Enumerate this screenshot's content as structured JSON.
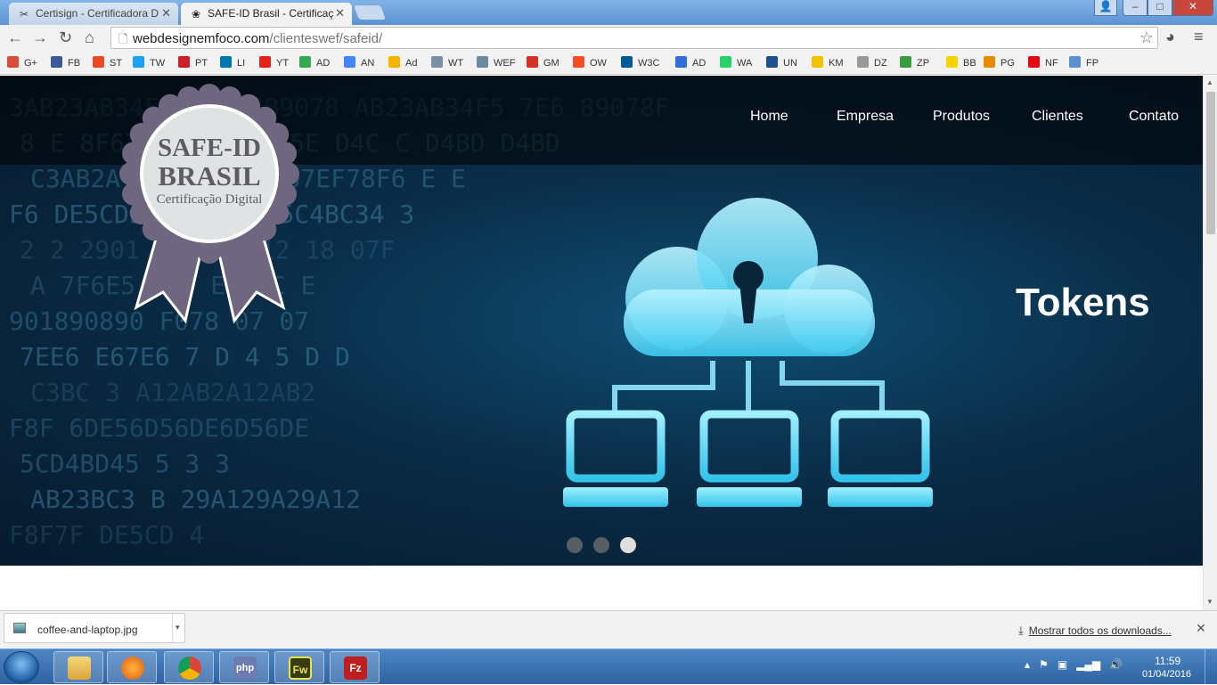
{
  "tabs": [
    {
      "title": "Certisign - Certificadora D",
      "active": false
    },
    {
      "title": "SAFE-ID Brasil - Certificaç",
      "active": true
    }
  ],
  "window_controls": {
    "minimize": "–",
    "maximize": "□",
    "close": "✕"
  },
  "address": {
    "host": "webdesignemfoco.com",
    "path": "/clienteswef/safeid/"
  },
  "bookmarks": [
    {
      "label": "G+",
      "color": "#dd4b39"
    },
    {
      "label": "FB",
      "color": "#3b5998"
    },
    {
      "label": "ST",
      "color": "#eb4924"
    },
    {
      "label": "TW",
      "color": "#1da1f2"
    },
    {
      "label": "PT",
      "color": "#cb2027"
    },
    {
      "label": "LI",
      "color": "#0077b5"
    },
    {
      "label": "YT",
      "color": "#e62117"
    },
    {
      "label": "AD",
      "color": "#34a853"
    },
    {
      "label": "AN",
      "color": "#4285f4"
    },
    {
      "label": "Ad",
      "color": "#f4b400"
    },
    {
      "label": "WT",
      "color": "#7a8fa8"
    },
    {
      "label": "WEF",
      "color": "#6a8aa0"
    },
    {
      "label": "GM",
      "color": "#d93025"
    },
    {
      "label": "OW",
      "color": "#f25022"
    },
    {
      "label": "W3C",
      "color": "#005a9c"
    },
    {
      "label": "AD",
      "color": "#2f6fdb"
    },
    {
      "label": "WA",
      "color": "#25d366"
    },
    {
      "label": "UN",
      "color": "#1d4f91"
    },
    {
      "label": "KM",
      "color": "#f2c200"
    },
    {
      "label": "DZ",
      "color": "#999999"
    },
    {
      "label": "ZP",
      "color": "#3a9d3a"
    },
    {
      "label": "BB",
      "color": "#f6d300"
    },
    {
      "label": "PG",
      "color": "#e68a00"
    },
    {
      "label": "NF",
      "color": "#e50914"
    },
    {
      "label": "FP",
      "color": "#5b8fd1"
    }
  ],
  "site": {
    "logo": {
      "line1": "SAFE-ID",
      "line2": "BRASIL",
      "line3": "Certificação Digital"
    },
    "nav": [
      "Home",
      "Empresa",
      "Produtos",
      "Clientes",
      "Contato"
    ],
    "slide_title": "Tokens",
    "slider": {
      "count": 3,
      "active": 3
    }
  },
  "hero_code_rows": [
    "3AB23AB34F  8F  8F6B9078  AB23AB34F5   7E6  89078F",
    "8  E  8F67E6 5E6 45 5E D4C  C   D4BD  D4BD",
    "C3AB2A  9 8  2 90 F07EF78F6 E E",
    "F6 DE5CDS 4CD C 5 5C4BC34 3",
    "2 2 2901 89  8 9012 18 07F",
    "A 7F6E5 7 F E D C E",
    "901890890  F078  07 07",
    "7EE6 E67E6 7 D 4 5 D D",
    "C3BC 3  A12AB2A12AB2",
    "F8F   6DE56D56DE6D56DE",
    "5CD4BD45 5 3 3",
    "AB23BC3 B 29A129A29A12",
    "F8F7F  DE5CD 4"
  ],
  "download": {
    "file": "coffee-and-laptop.jpg",
    "show_all": "Mostrar todos os downloads..."
  },
  "taskbar": {
    "apps": [
      {
        "name": "explorer",
        "label": ""
      },
      {
        "name": "firefox",
        "label": ""
      },
      {
        "name": "chrome",
        "label": ""
      },
      {
        "name": "php",
        "label": "php"
      },
      {
        "name": "fireworks",
        "label": "Fw"
      },
      {
        "name": "filezilla",
        "label": "Fz"
      }
    ],
    "time": "11:59",
    "date": "01/04/2016"
  }
}
